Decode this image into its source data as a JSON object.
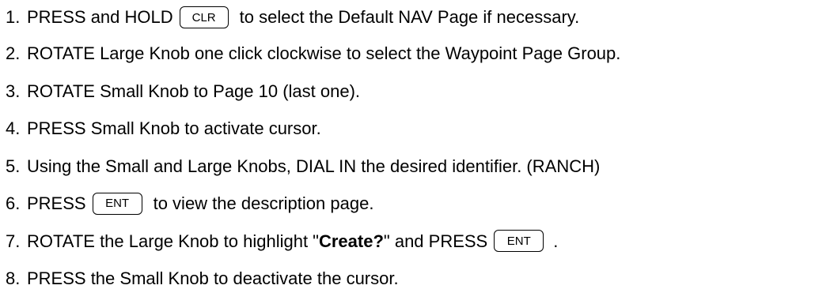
{
  "steps": [
    {
      "num": "1.",
      "before": "PRESS and HOLD",
      "key": "CLR",
      "after": "to select the Default NAV Page if necessary."
    },
    {
      "num": "2.",
      "text": "ROTATE Large Knob one click clockwise to select the Waypoint Page Group."
    },
    {
      "num": "3.",
      "text": "ROTATE Small Knob to Page 10 (last one)."
    },
    {
      "num": "4.",
      "text": "PRESS Small Knob to activate cursor."
    },
    {
      "num": "5.",
      "text": "Using the Small and Large Knobs, DIAL IN the desired identifier. (RANCH)"
    },
    {
      "num": "6.",
      "before": "PRESS",
      "key": "ENT",
      "after": "to view the description page."
    },
    {
      "num": "7.",
      "before": "ROTATE the Large Knob to highlight \"",
      "bold": "Create?",
      "middle": "\" and PRESS",
      "key": "ENT",
      "after": "."
    },
    {
      "num": "8.",
      "text": "PRESS the Small Knob to deactivate the cursor."
    }
  ]
}
